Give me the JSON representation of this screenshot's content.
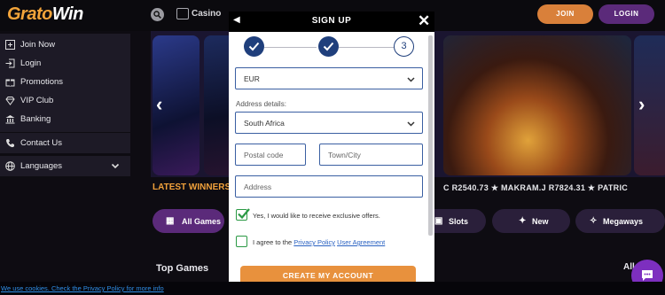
{
  "header": {
    "logo_part1": "Grato",
    "logo_part2": "Win",
    "casino_label": "Casino",
    "join_label": "JOIN",
    "login_label": "LOGIN"
  },
  "sidebar": {
    "items": [
      {
        "label": "Join Now",
        "icon": "user-plus-icon"
      },
      {
        "label": "Login",
        "icon": "login-icon"
      },
      {
        "label": "Promotions",
        "icon": "gift-icon"
      },
      {
        "label": "VIP Club",
        "icon": "diamond-icon"
      },
      {
        "label": "Banking",
        "icon": "bank-icon"
      },
      {
        "label": "Contact Us",
        "icon": "phone-icon"
      },
      {
        "label": "Languages",
        "icon": "globe-icon"
      }
    ]
  },
  "winners": {
    "title": "LATEST WINNERS",
    "ticker": "C R2540.73  ★ MAKRAM.J R7824.31  ★ PATRIC"
  },
  "categories": [
    {
      "label": "All Games",
      "icon": "grid-icon"
    },
    {
      "label": "Slots",
      "icon": "slots-icon"
    },
    {
      "label": "New",
      "icon": "sparkle-icon"
    },
    {
      "label": "Megaways",
      "icon": "megaways-icon"
    }
  ],
  "main": {
    "top_games_title": "Top Games",
    "all_label": "All"
  },
  "cookie_bar": {
    "text": "We use cookies. Check the Privacy Policy for more info"
  },
  "modal": {
    "title": "SIGN UP",
    "step_current": "3",
    "currency_value": "EUR",
    "address_label": "Address details:",
    "country_value": "South Africa",
    "postal_placeholder": "Postal code",
    "city_placeholder": "Town/City",
    "address_placeholder": "Address",
    "offers_text": "Yes, I would like to receive exclusive offers.",
    "offers_checked": true,
    "agree_prefix": "I agree to the ",
    "privacy_link": "Privacy Policy",
    "agreement_link": "User Agreement",
    "agree_checked": false,
    "create_label": "CREATE MY ACCOUNT"
  },
  "colors": {
    "brand_orange": "#e8913d",
    "brand_purple": "#5b2a7a",
    "step_blue": "#1f3f7c",
    "check_green": "#2a9944"
  }
}
